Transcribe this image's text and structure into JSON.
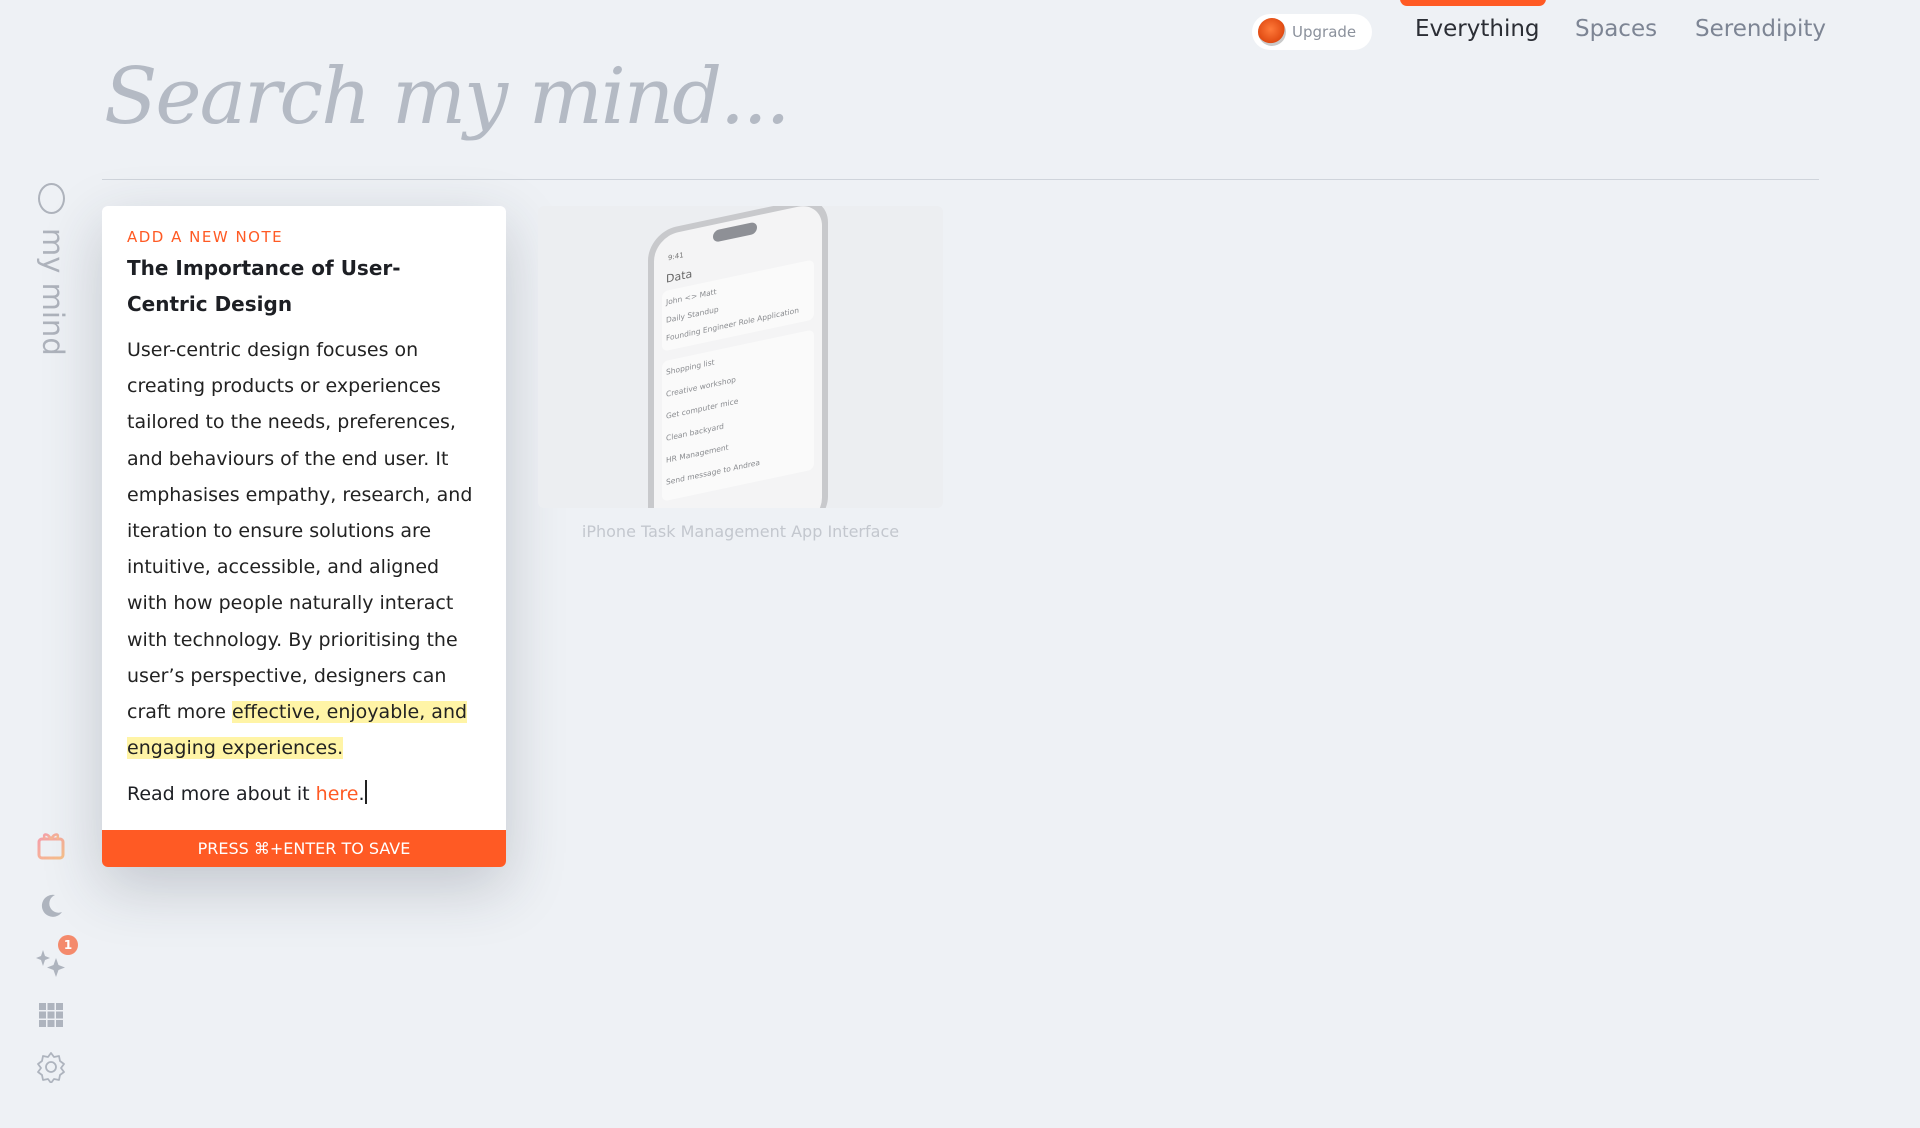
{
  "header": {
    "upgrade_label": "Upgrade",
    "tabs": [
      {
        "label": "Everything",
        "active": true
      },
      {
        "label": "Spaces"
      },
      {
        "label": "Serendipity"
      }
    ]
  },
  "search": {
    "placeholder": "Search my mind..."
  },
  "sidebar": {
    "title": "my mind",
    "icons": [
      "gift-icon",
      "moon-icon",
      "sparkles-icon",
      "grid-icon",
      "gear-icon"
    ],
    "badge": "1"
  },
  "note": {
    "label": "ADD A NEW NOTE",
    "title": "The Importance of User-Centric Design",
    "body": "User-centric design focuses on creating products or experiences tailored to the needs, preferences, and behaviours of the end user. It emphasises empathy, research, and iteration to ensure solutions are intuitive, accessible, and aligned with how people naturally interact with technology. By prioritising the user’s perspective, designers can craft more ",
    "highlight": "effective, enjoyable, and engaging experiences.",
    "more_prefix": "Read more about it ",
    "more_link": "here",
    "more_suffix": ".",
    "save_label": "PRESS ⌘+ENTER TO SAVE"
  },
  "cards": [
    {
      "caption": "iPhone Task Management App Interface",
      "phone": {
        "time": "9:41",
        "heading": "Data",
        "today": [
          "John <> Matt",
          "Daily Standup",
          "Founding Engineer Role Application"
        ],
        "yesterday": [
          "Shopping list",
          "Creative workshop",
          "Get computer mice",
          "Clean backyard",
          "HR Management",
          "Send message to Andrea"
        ]
      }
    }
  ],
  "colors": {
    "accent": "#ff5a24",
    "highlight": "#fff4a6",
    "background": "#eef1f5"
  }
}
